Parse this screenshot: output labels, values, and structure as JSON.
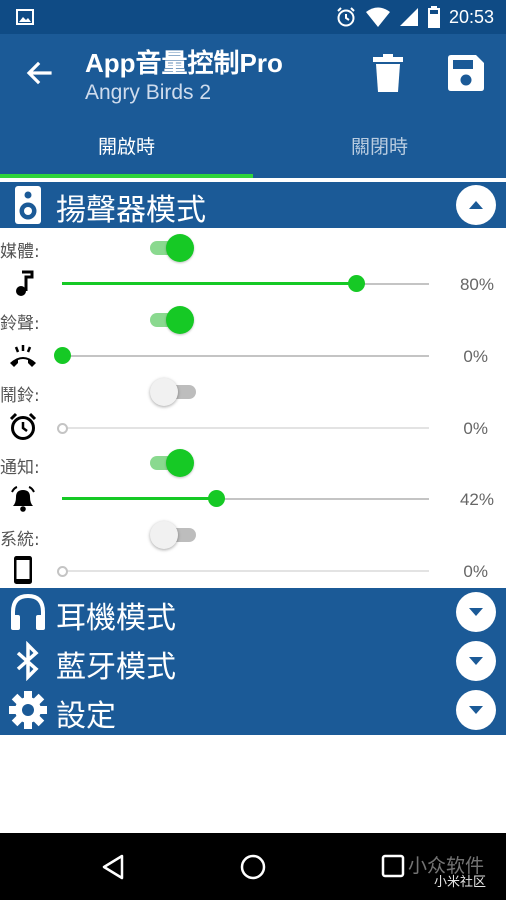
{
  "status": {
    "time": "20:53"
  },
  "appbar": {
    "title": "App音量控制Pro",
    "subtitle": "Angry Birds 2"
  },
  "tabs": [
    {
      "label": "開啟時",
      "active": true
    },
    {
      "label": "關閉時",
      "active": false
    }
  ],
  "accent_color": "#16c925",
  "speaker_section": {
    "label": "揚聲器模式",
    "expanded": true,
    "rows": [
      {
        "label": "媒體:",
        "enabled": true,
        "icon": "music-note-icon",
        "percent_label": "80%",
        "level": 0.8
      },
      {
        "label": "鈴聲:",
        "enabled": true,
        "icon": "ringer-icon",
        "percent_label": "0%",
        "level": 0.0
      },
      {
        "label": "鬧鈴:",
        "enabled": false,
        "icon": "alarm-clock-icon",
        "percent_label": "0%",
        "level": 0.0
      },
      {
        "label": "通知:",
        "enabled": true,
        "icon": "bell-icon",
        "percent_label": "42%",
        "level": 0.42
      },
      {
        "label": "系統:",
        "enabled": false,
        "icon": "phone-icon",
        "percent_label": "0%",
        "level": 0.0
      }
    ]
  },
  "sections": [
    {
      "label": "耳機模式",
      "icon": "headphones-icon",
      "expanded": false
    },
    {
      "label": "藍牙模式",
      "icon": "bluetooth-icon",
      "expanded": false
    },
    {
      "label": "設定",
      "icon": "gear-icon",
      "expanded": false
    }
  ],
  "watermark": {
    "line1": "小众软件",
    "line2": "小米社区"
  }
}
